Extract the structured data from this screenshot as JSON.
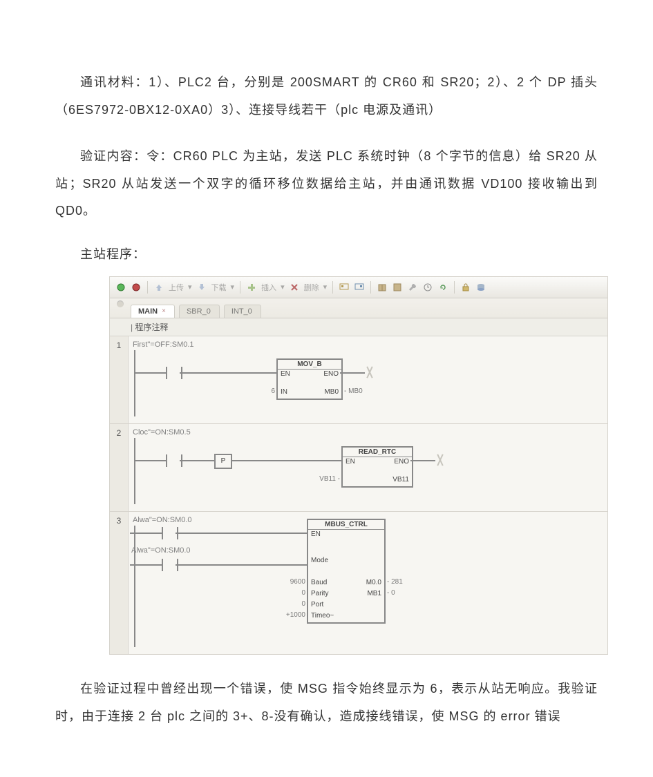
{
  "paragraphs": {
    "p1": "通讯材料：1）、PLC2 台，分别是 200SMART 的 CR60 和 SR20；2）、2 个 DP 插头（6ES7972-0BX12-0XA0）3）、连接导线若干（plc 电源及通讯）",
    "p2": "验证内容：令：CR60 PLC 为主站，发送 PLC 系统时钟（8 个字节的信息）给 SR20 从站；SR20 从站发送一个双字的循环移位数据给主站，并由通讯数据 VD100 接收输出到 QD0。",
    "p3_head": "主站程序：",
    "p4": "在验证过程中曾经出现一个错误，使 MSG 指令始终显示为 6，表示从站无响应。我验证时，由于连接 2 台 plc 之间的 3+、8-没有确认，造成接线错误，使 MSG 的 error 错误"
  },
  "toolbar": {
    "upload": "上传",
    "download": "下载",
    "insert": "插入",
    "delete": "删除"
  },
  "tabs": {
    "main": "MAIN",
    "sbr": "SBR_0",
    "int": "INT_0"
  },
  "comment_row": "程序注释",
  "network1": {
    "comment": "First\"=OFF:SM0.1",
    "block": {
      "title": "MOV_B",
      "en": "EN",
      "eno": "ENO",
      "in_label": "IN",
      "in_val": "6",
      "out_label": "MB0",
      "out_ext": "- MB0"
    }
  },
  "network2": {
    "comment": "Cloc\"=ON:SM0.5",
    "p": "P",
    "block": {
      "title": "READ_RTC",
      "en": "EN",
      "eno": "ENO",
      "out_label": "VB11",
      "out_ext_l": "VB11 -"
    }
  },
  "network3": {
    "comment1": "Alwa\"=ON:SM0.0",
    "comment2": "Alwa\"=ON:SM0.0",
    "block": {
      "title": "MBUS_CTRL",
      "en": "EN",
      "mode": "Mode",
      "baud": "Baud",
      "baud_val": "9600",
      "baud_out": "M0.0",
      "parity": "Parity",
      "parity_val": "0",
      "parity_out": "MB1",
      "port": "Port",
      "port_val": "0",
      "timeout": "Timeo~",
      "timeout_val": "+1000",
      "right_tail1": "- 281",
      "right_tail2": "- 0"
    }
  }
}
